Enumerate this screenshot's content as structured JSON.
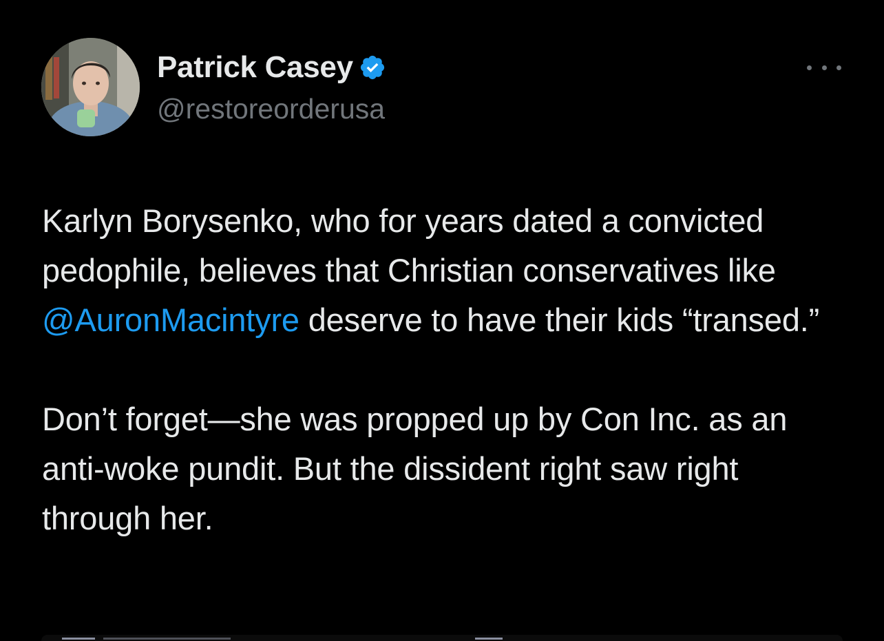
{
  "tweet": {
    "author": {
      "display_name": "Patrick Casey",
      "handle": "@restoreorderusa",
      "verified": true,
      "avatar_icon": "profile-photo"
    },
    "more_icon": "ellipsis-icon",
    "paragraphs": [
      {
        "before": "Karlyn Borysenko, who for years dated a convicted pedophile, believes that Christian conservatives like ",
        "mention": "@AuronMacintyre",
        "after": " deserve to have their kids “transed.”"
      },
      {
        "text": "Don’t forget—she was propped up by Con Inc. as an anti-woke pundit. But the dissident right saw right through her."
      }
    ]
  },
  "colors": {
    "background": "#000000",
    "primary_text": "#e7e9ea",
    "secondary_text": "#71767b",
    "accent": "#1d9bf0"
  }
}
